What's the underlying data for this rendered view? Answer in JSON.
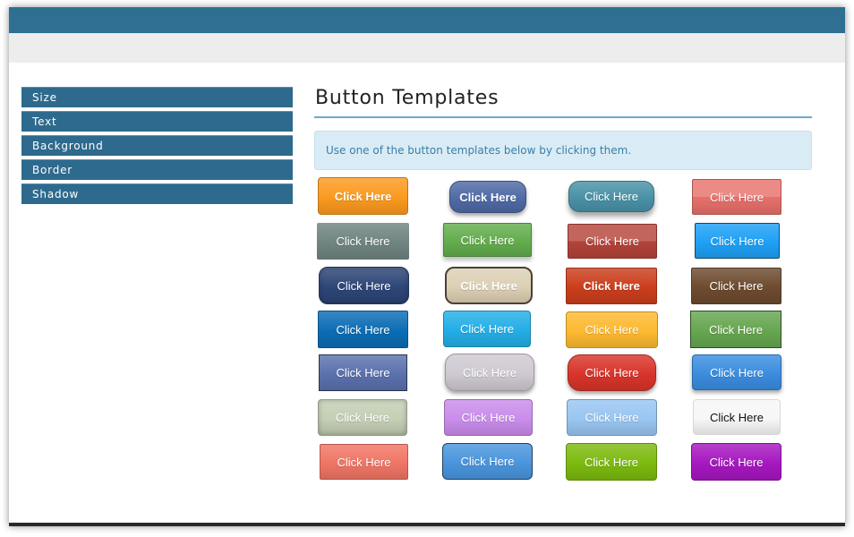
{
  "window": {
    "header_color": "#2f6f91",
    "subheader_color": "#ededed"
  },
  "sidebar": {
    "items": [
      {
        "label": "Size"
      },
      {
        "label": "Text"
      },
      {
        "label": "Background"
      },
      {
        "label": "Border"
      },
      {
        "label": "Shadow"
      }
    ]
  },
  "main": {
    "title": "Button Templates",
    "info": "Use one of the button templates below by clicking them."
  },
  "buttons": [
    {
      "label": "Click Here",
      "style": "orange-gloss",
      "bg": "#fb9a1f",
      "text": "#ffffff"
    },
    {
      "label": "Click Here",
      "style": "blue-pill",
      "bg": "#4f6aa5",
      "text": "#ffffff"
    },
    {
      "label": "Click Here",
      "style": "teal-pill",
      "bg": "#4a91a7",
      "text": "#ffffff"
    },
    {
      "label": "Click Here",
      "style": "salmon-flat",
      "bg": "#e8706b",
      "text": "#ffffff"
    },
    {
      "label": "Click Here",
      "style": "slate-gray",
      "bg": "#6f8480",
      "text": "#ffffff"
    },
    {
      "label": "Click Here",
      "style": "green-raised",
      "bg": "#63ad4d",
      "text": "#ffffff"
    },
    {
      "label": "Click Here",
      "style": "brick-red",
      "bg": "#b4443a",
      "text": "#ffffff"
    },
    {
      "label": "Click Here",
      "style": "sky-bordered",
      "bg": "#1ea0f5",
      "text": "#ffffff"
    },
    {
      "label": "Click Here",
      "style": "navy-rounded",
      "bg": "#2d4677",
      "text": "#ffffff"
    },
    {
      "label": "Click Here",
      "style": "beige-rounded",
      "bg": "#dcd0b4",
      "text": "#ffffff"
    },
    {
      "label": "Click Here",
      "style": "orange-red",
      "bg": "#cb3e1c",
      "text": "#ffffff"
    },
    {
      "label": "Click Here",
      "style": "brown",
      "bg": "#6d4b2f",
      "text": "#ffffff"
    },
    {
      "label": "Click Here",
      "style": "ocean-blue",
      "bg": "#0b6db5",
      "text": "#ffffff"
    },
    {
      "label": "Click Here",
      "style": "cyan",
      "bg": "#23aee6",
      "text": "#ffffff"
    },
    {
      "label": "Click Here",
      "style": "gold",
      "bg": "#fdb930",
      "text": "#ffffff"
    },
    {
      "label": "Click Here",
      "style": "grass-green",
      "bg": "#66a650",
      "text": "#ffffff"
    },
    {
      "label": "Click Here",
      "style": "periwinkle",
      "bg": "#5b71ad",
      "text": "#ffffff"
    },
    {
      "label": "Click Here",
      "style": "silver-pill",
      "bg": "#cfc9d2",
      "text": "#ffffff"
    },
    {
      "label": "Click Here",
      "style": "red-pill",
      "bg": "#d8342a",
      "text": "#ffffff"
    },
    {
      "label": "Click Here",
      "style": "blue-3d",
      "bg": "#3b8de0",
      "text": "#ffffff"
    },
    {
      "label": "Click Here",
      "style": "sage",
      "bg": "#c4cfb5",
      "text": "#ffffff"
    },
    {
      "label": "Click Here",
      "style": "lavender",
      "bg": "#c98ceb",
      "text": "#ffffff"
    },
    {
      "label": "Click Here",
      "style": "light-blue",
      "bg": "#98c6f2",
      "text": "#ffffff"
    },
    {
      "label": "Click Here",
      "style": "white",
      "bg": "#f7f7f7",
      "text": "#111111"
    },
    {
      "label": "Click Here",
      "style": "coral",
      "bg": "#f07565",
      "text": "#ffffff"
    },
    {
      "label": "Click Here",
      "style": "steel-blue",
      "bg": "#4a95dc",
      "text": "#ffffff"
    },
    {
      "label": "Click Here",
      "style": "lime",
      "bg": "#7cba0f",
      "text": "#ffffff"
    },
    {
      "label": "Click Here",
      "style": "purple",
      "bg": "#a617c0",
      "text": "#ffffff"
    }
  ]
}
